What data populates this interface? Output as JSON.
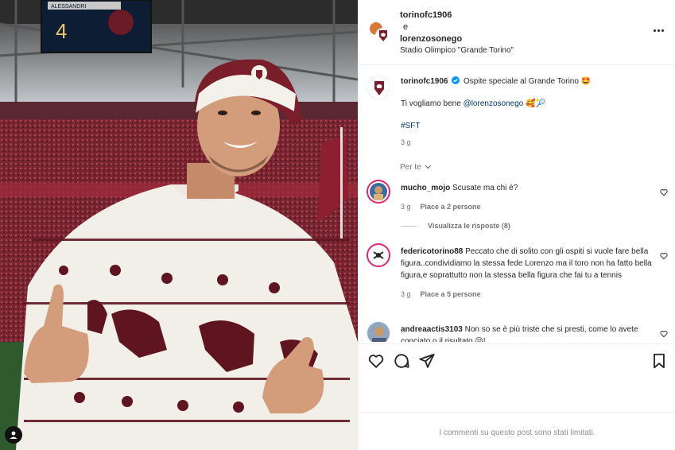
{
  "post": {
    "author": "torinofc1906",
    "joiner": "e",
    "coauthor": "lorenzosonego",
    "location": "Stadio Olimpico \"Grande Torino\"",
    "caption_author": "torinofc1906",
    "caption_line1": "Ospite speciale al Grande Torino 🤩",
    "caption_line2_prefix": "Ti vogliamo bene ",
    "caption_mention": "@lorenzosonego",
    "caption_line2_suffix": " 🥰🎾",
    "hashtag": "#SFT",
    "time": "3 g",
    "photo_scoreboard": "4",
    "photo_scoreboard_name": "ALESSANDRI"
  },
  "comments_section": {
    "sort_label": "Per te",
    "items": [
      {
        "user": "mucho_mojo",
        "text": "Scusate ma chi è?",
        "time": "3 g",
        "likes": "Piace a 2 persone",
        "view_replies": "Visualizza le risposte (8)"
      },
      {
        "user": "federicotorino88",
        "text": "Peccato che di solito con gli ospiti si vuole fare bella figura..condividiamo la stessa fede Lorenzo ma il toro non ha fatto bella figura,e soprattutto non la stessa bella figura che fai tu a tennis",
        "time": "3 g",
        "likes": "Piace a 5 persone"
      },
      {
        "user": "andreaactis3103",
        "text": "Non so se è più triste che si presti, come lo avete conciato o il risultato 😒!"
      }
    ]
  },
  "footer": {
    "limited_text": "I commenti su questo post sono stati limitati."
  },
  "icons": {
    "like": "heart-icon",
    "comment": "comment-icon",
    "share": "share-icon",
    "save": "bookmark-icon",
    "more": "more-icon",
    "verified": "verified-badge-icon",
    "tag": "user-tag-icon"
  },
  "colors": {
    "torino_maroon": "#7a1f2e",
    "verified_blue": "#0095f6",
    "mention_blue": "#00376b"
  }
}
